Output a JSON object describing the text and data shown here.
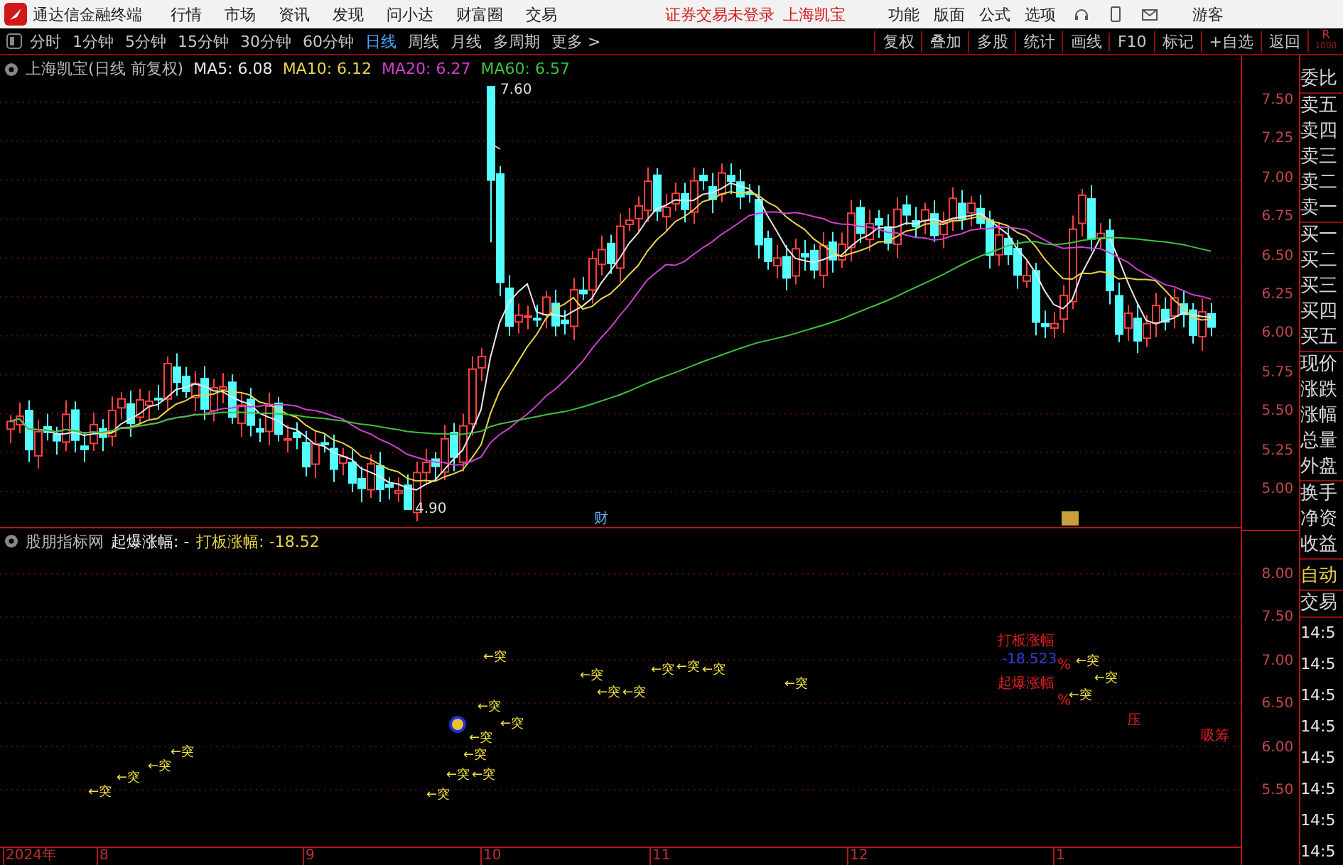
{
  "title_bar": {
    "app_name": "通达信金融终端",
    "menu": [
      "行情",
      "市场",
      "资讯",
      "发现",
      "问小达",
      "财富圈",
      "交易"
    ],
    "notice": "证券交易未登录",
    "stock_name": "上海凯宝",
    "tools": [
      "功能",
      "版面",
      "公式",
      "选项"
    ],
    "user": "游客"
  },
  "period_bar": {
    "periods": [
      {
        "label": "分时",
        "selected": false
      },
      {
        "label": "1分钟",
        "selected": false
      },
      {
        "label": "5分钟",
        "selected": false
      },
      {
        "label": "15分钟",
        "selected": false
      },
      {
        "label": "30分钟",
        "selected": false
      },
      {
        "label": "60分钟",
        "selected": false
      },
      {
        "label": "日线",
        "selected": true
      },
      {
        "label": "周线",
        "selected": false
      },
      {
        "label": "月线",
        "selected": false
      },
      {
        "label": "多周期",
        "selected": false
      },
      {
        "label": "更多 >",
        "selected": false
      }
    ],
    "actions": [
      "复权",
      "叠加",
      "多股",
      "统计",
      "画线",
      "F10",
      "标记",
      "+自选",
      "返回"
    ],
    "corner": [
      "R",
      "1000"
    ]
  },
  "main_chart": {
    "title": "上海凯宝(日线 前复权)",
    "ma": [
      {
        "label": "MA5: 6.08",
        "color": "#e8e8e8"
      },
      {
        "label": "MA10: 6.12",
        "color": "#e8d44a"
      },
      {
        "label": "MA20: 6.27",
        "color": "#d040d0"
      },
      {
        "label": "MA60: 6.57",
        "color": "#40c040"
      }
    ],
    "y_axis": [
      "7.50",
      "7.25",
      "7.00",
      "6.75",
      "6.50",
      "6.25",
      "6.00",
      "5.75",
      "5.50",
      "5.25",
      "5.00"
    ],
    "high_label": "7.60",
    "low_label": "4.90",
    "event_label": "财"
  },
  "indicator": {
    "source": "股朋指标网",
    "qibao": "起爆涨幅: -",
    "daban": "打板涨幅: -18.52",
    "y_axis": [
      "8.00",
      "7.50",
      "7.00",
      "6.50",
      "6.00",
      "5.50"
    ],
    "markers": [
      "←突",
      "←突",
      "←突",
      "←突",
      "←突",
      "←突",
      "←突",
      "←突",
      "←突",
      "←突",
      "←突",
      "←突",
      "←突",
      "←突",
      "←突",
      "←突",
      "←突",
      "←突",
      "←突",
      "←突",
      "←突",
      "←突"
    ],
    "notes": [
      {
        "text": "打板涨幅",
        "kind": "label"
      },
      {
        "text": "-18.523",
        "kind": "value"
      },
      {
        "text": "%",
        "kind": "label"
      },
      {
        "text": "起爆涨幅",
        "kind": "label"
      },
      {
        "text": "%",
        "kind": "label"
      },
      {
        "text": "压",
        "kind": "label"
      },
      {
        "text": "吸筹",
        "kind": "label"
      }
    ]
  },
  "date_axis": [
    "2024年",
    "8",
    "9",
    "10",
    "11",
    "12",
    "1"
  ],
  "quote_panel": {
    "items": [
      "委比",
      "卖五",
      "卖四",
      "卖三",
      "卖二",
      "卖一",
      "买一",
      "买二",
      "买三",
      "买四",
      "买五",
      "现价",
      "涨跌",
      "涨幅",
      "总量",
      "外盘",
      "换手",
      "净资",
      "收益"
    ],
    "auto": "自动",
    "trade": "交易",
    "times": [
      "14:5",
      "14:5",
      "14:5",
      "14:5",
      "14:5",
      "14:5",
      "14:5",
      "14:5"
    ]
  }
}
